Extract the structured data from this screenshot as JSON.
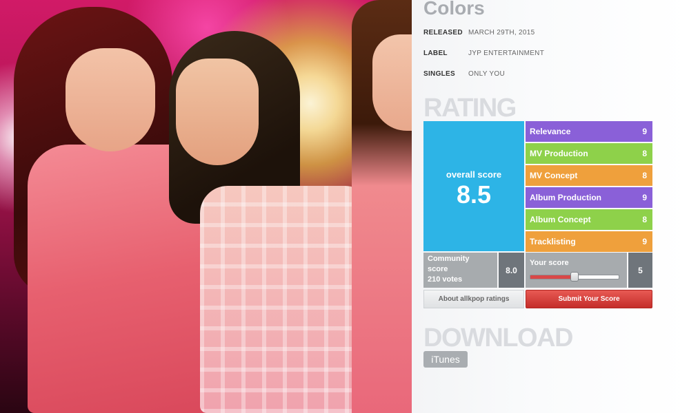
{
  "album": {
    "title": "Colors",
    "meta": [
      {
        "key": "RELEASED",
        "value": "MARCH 29TH, 2015"
      },
      {
        "key": "LABEL",
        "value": "JYP ENTERTAINMENT"
      },
      {
        "key": "SINGLES",
        "value": "ONLY YOU"
      }
    ]
  },
  "rating": {
    "heading": "RATING",
    "overall_label": "overall score",
    "overall_score": "8.5",
    "categories": [
      {
        "label": "Relevance",
        "score": "9",
        "color": "#8a60d8"
      },
      {
        "label": "MV Production",
        "score": "8",
        "color": "#8ed14a"
      },
      {
        "label": "MV Concept",
        "score": "8",
        "color": "#efa03c"
      },
      {
        "label": "Album Production",
        "score": "9",
        "color": "#8a60d8"
      },
      {
        "label": "Album Concept",
        "score": "8",
        "color": "#8ed14a"
      },
      {
        "label": "Tracklisting",
        "score": "9",
        "color": "#efa03c"
      }
    ],
    "community": {
      "label_line1": "Community",
      "label_line2": "score",
      "votes": "210 votes",
      "score": "8.0"
    },
    "your_score": {
      "label": "Your score",
      "value": "5",
      "slider_fraction": 0.5
    },
    "about_button": "About allkpop ratings",
    "submit_button": "Submit Your Score"
  },
  "download": {
    "heading": "DOWNLOAD",
    "itunes_label": "iTunes"
  },
  "colors": {
    "overall_bg": "#2db4e6",
    "purple": "#8a60d8",
    "green": "#8ed14a",
    "orange": "#efa03c",
    "submit": "#d94848"
  }
}
